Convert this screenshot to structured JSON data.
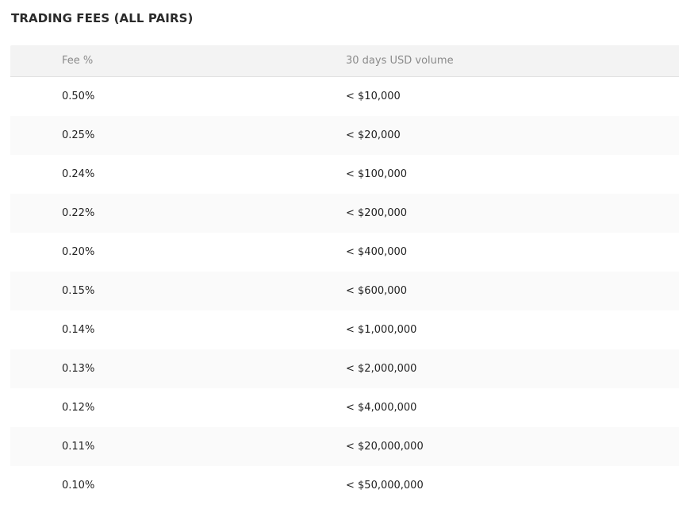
{
  "title": "TRADING FEES (ALL PAIRS)",
  "table": {
    "headers": {
      "fee": "Fee %",
      "volume": "30 days USD volume"
    },
    "rows": [
      {
        "fee": "0.50%",
        "volume": "< $10,000"
      },
      {
        "fee": "0.25%",
        "volume": "< $20,000"
      },
      {
        "fee": "0.24%",
        "volume": "< $100,000"
      },
      {
        "fee": "0.22%",
        "volume": "< $200,000"
      },
      {
        "fee": "0.20%",
        "volume": "< $400,000"
      },
      {
        "fee": "0.15%",
        "volume": "< $600,000"
      },
      {
        "fee": "0.14%",
        "volume": "< $1,000,000"
      },
      {
        "fee": "0.13%",
        "volume": "< $2,000,000"
      },
      {
        "fee": "0.12%",
        "volume": "< $4,000,000"
      },
      {
        "fee": "0.11%",
        "volume": "< $20,000,000"
      },
      {
        "fee": "0.10%",
        "volume": "< $50,000,000"
      }
    ]
  },
  "colors": {
    "header_bg": "#f3f3f3",
    "stripe_bg": "#fafafa",
    "header_text": "#8a8a8a",
    "body_text": "#222222"
  }
}
